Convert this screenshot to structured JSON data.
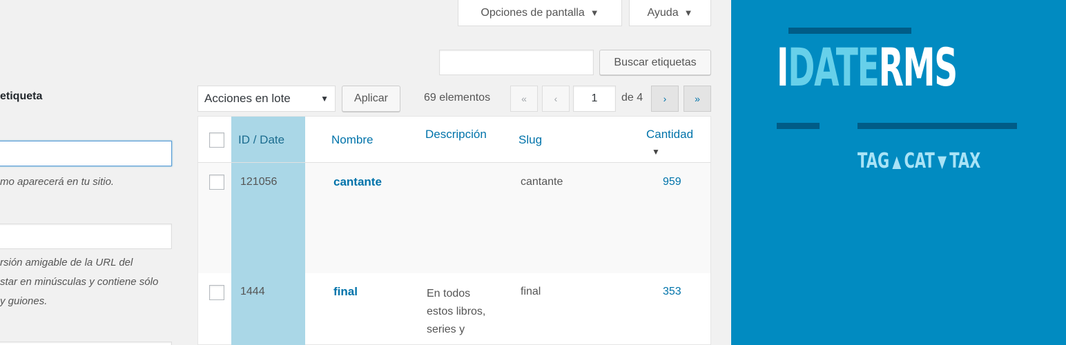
{
  "screen_options": {
    "label": "Opciones de pantalla",
    "caret": "▼"
  },
  "help": {
    "label": "Ayuda",
    "caret": "▼"
  },
  "search": {
    "value": "",
    "button": "Buscar etiquetas"
  },
  "form": {
    "heading": "etiqueta",
    "name_value": "",
    "name_help": "mo aparecerá en tu sitio.",
    "slug_value": "",
    "slug_help": [
      "rsión amigable de la URL del",
      "star en minúsculas y contiene sólo",
      "y guiones."
    ]
  },
  "bulk": {
    "selected": "Acciones en lote",
    "arrow": "▼",
    "apply": "Aplicar"
  },
  "pagination": {
    "count": "69 elementos",
    "first": "«",
    "prev": "‹",
    "current": "1",
    "of": "de 4",
    "next": "›",
    "last": "»"
  },
  "table": {
    "columns": {
      "id": "ID / Date",
      "name": "Nombre",
      "description": "Descripción",
      "slug": "Slug",
      "count": "Cantidad",
      "sort_icon": "▼"
    },
    "rows": [
      {
        "id": "121056",
        "name": "cantante",
        "description": [],
        "slug": "cantante",
        "count": "959"
      },
      {
        "id": "1444",
        "name": "final",
        "description": [
          "En todos",
          "estos libros,",
          "series y"
        ],
        "slug": "final",
        "count": "353"
      }
    ]
  },
  "banner": {
    "logo_part1": "I",
    "logo_part2": "DATE",
    "logo_part3": "RMS",
    "tag": "TAG",
    "cat": "CAT",
    "tax": "TAX",
    "up_icon": "▲",
    "down_icon": "▼",
    "colors": {
      "background": "#018bc1",
      "accent": "#67d0ea",
      "bar": "#005c87"
    }
  }
}
